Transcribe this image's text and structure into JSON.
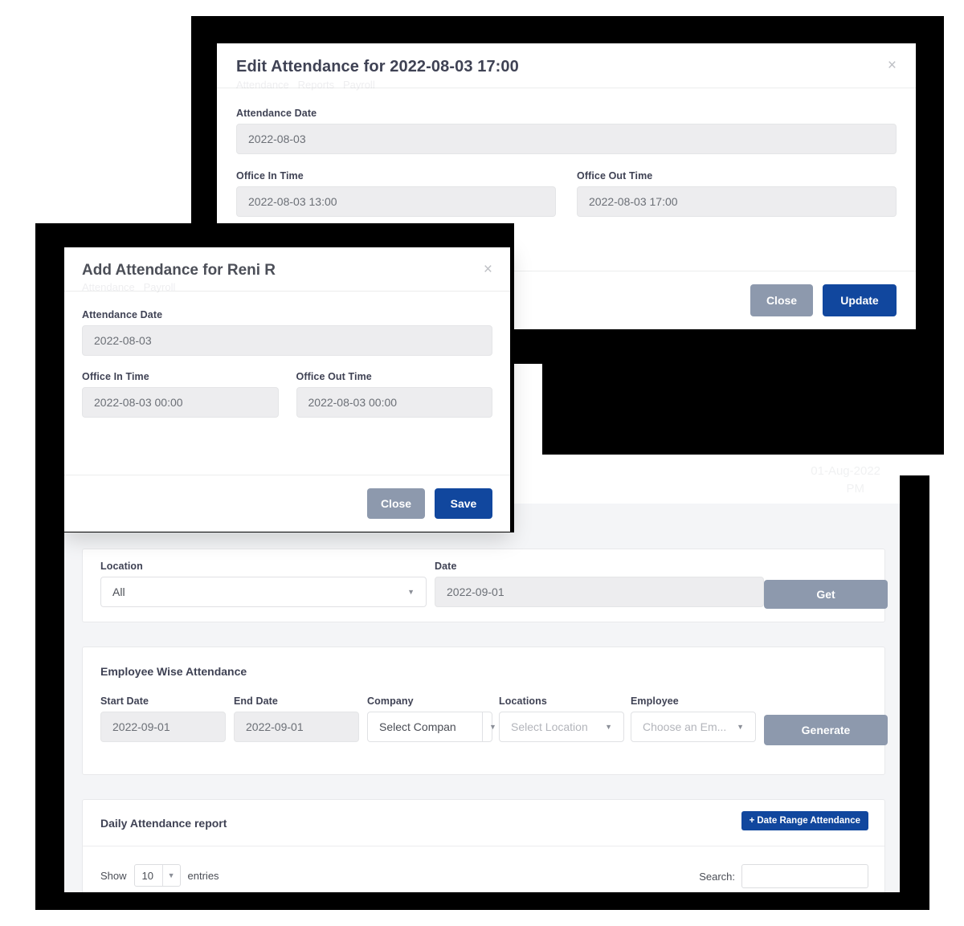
{
  "edit_modal": {
    "title": "Edit Attendance for 2022-08-03 17:00",
    "close_icon": "×",
    "fields": {
      "attendance_date_label": "Attendance Date",
      "attendance_date_value": "2022-08-03",
      "office_in_label": "Office In Time",
      "office_in_value": "2022-08-03 13:00",
      "office_out_label": "Office Out Time",
      "office_out_value": "2022-08-03 17:00"
    },
    "close_button": "Close",
    "primary_button": "Update"
  },
  "add_modal": {
    "title": "Add Attendance for Reni R",
    "close_icon": "×",
    "fields": {
      "attendance_date_label": "Attendance Date",
      "attendance_date_value": "2022-08-03",
      "office_in_label": "Office In Time",
      "office_in_value": "2022-08-03 00:00",
      "office_out_label": "Office Out Time",
      "office_out_value": "2022-08-03 00:00"
    },
    "close_button": "Close",
    "primary_button": "Save"
  },
  "page": {
    "filter_card": {
      "location_label": "Location",
      "location_value": "All",
      "date_label": "Date",
      "date_value": "2022-09-01",
      "get_button": "Get"
    },
    "employee_wise": {
      "heading": "Employee Wise Attendance",
      "start_date_label": "Start Date",
      "start_date_value": "2022-09-01",
      "end_date_label": "End Date",
      "end_date_value": "2022-09-01",
      "company_label": "Company",
      "company_value": "Select Compan",
      "locations_label": "Locations",
      "locations_value": "Select Location",
      "employee_label": "Employee",
      "employee_value": "Choose an Em...",
      "generate_button": "Generate"
    },
    "daily_report": {
      "heading": "Daily Attendance report",
      "date_range_button": "Date Range Attendance",
      "date_range_icon": "+",
      "show_label": "Show",
      "show_value": "10",
      "entries_label": "entries",
      "search_label": "Search:",
      "search_value": ""
    }
  },
  "colors": {
    "primary_blue": "#11479e",
    "muted_grey": "#8d99ad",
    "backdrop": "#000000",
    "input_bg": "#ededef"
  }
}
